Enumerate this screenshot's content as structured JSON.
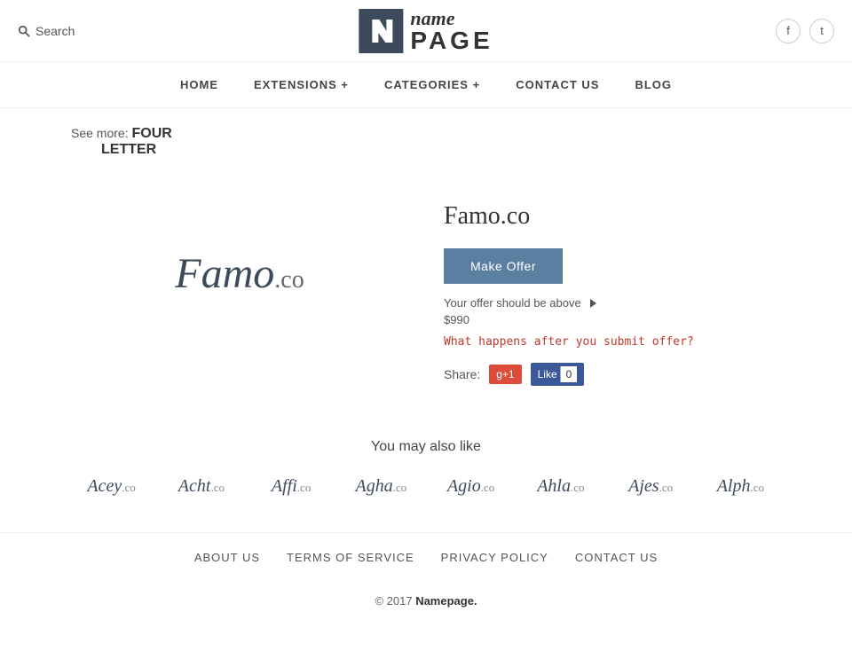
{
  "header": {
    "search_label": "Search",
    "logo_icon": "n",
    "logo_name": "name",
    "logo_page": "PAGE",
    "social_facebook": "f",
    "social_twitter": "t"
  },
  "nav": {
    "items": [
      {
        "label": "HOME",
        "has_dropdown": false
      },
      {
        "label": "EXTENSIONS +",
        "has_dropdown": true
      },
      {
        "label": "CATEGORIES +",
        "has_dropdown": true
      },
      {
        "label": "CONTACT US",
        "has_dropdown": false
      },
      {
        "label": "BLOG",
        "has_dropdown": false
      }
    ]
  },
  "breadcrumb": {
    "see_more_text": "See more:",
    "tag1": "FOUR",
    "tag2": "LETTER"
  },
  "domain": {
    "name_styled": "Famo",
    "ext": ".co",
    "full_name": "Famo.co",
    "make_offer_label": "Make Offer",
    "offer_hint": "Your offer should be above",
    "offer_amount": "$990",
    "submit_link_text": "What happens after you submit offer?",
    "share_label": "Share:",
    "gplus_label": "g+1",
    "fb_like_label": "Like",
    "fb_count": "0"
  },
  "also_like": {
    "title": "You may also like",
    "domains": [
      {
        "name": "Acey",
        "ext": ".co"
      },
      {
        "name": "Acht",
        "ext": ".co"
      },
      {
        "name": "Affi",
        "ext": ".co"
      },
      {
        "name": "Agha",
        "ext": ".co"
      },
      {
        "name": "Agio",
        "ext": ".co"
      },
      {
        "name": "Ahla",
        "ext": ".co"
      },
      {
        "name": "Ajes",
        "ext": ".co"
      },
      {
        "name": "Alph",
        "ext": ".co"
      }
    ]
  },
  "footer": {
    "links": [
      {
        "label": "ABOUT US"
      },
      {
        "label": "TERMS OF SERVICE"
      },
      {
        "label": "PRIVACY POLICY"
      },
      {
        "label": "CONTACT US"
      }
    ],
    "copyright": "© 2017",
    "brand": "Namepage."
  }
}
